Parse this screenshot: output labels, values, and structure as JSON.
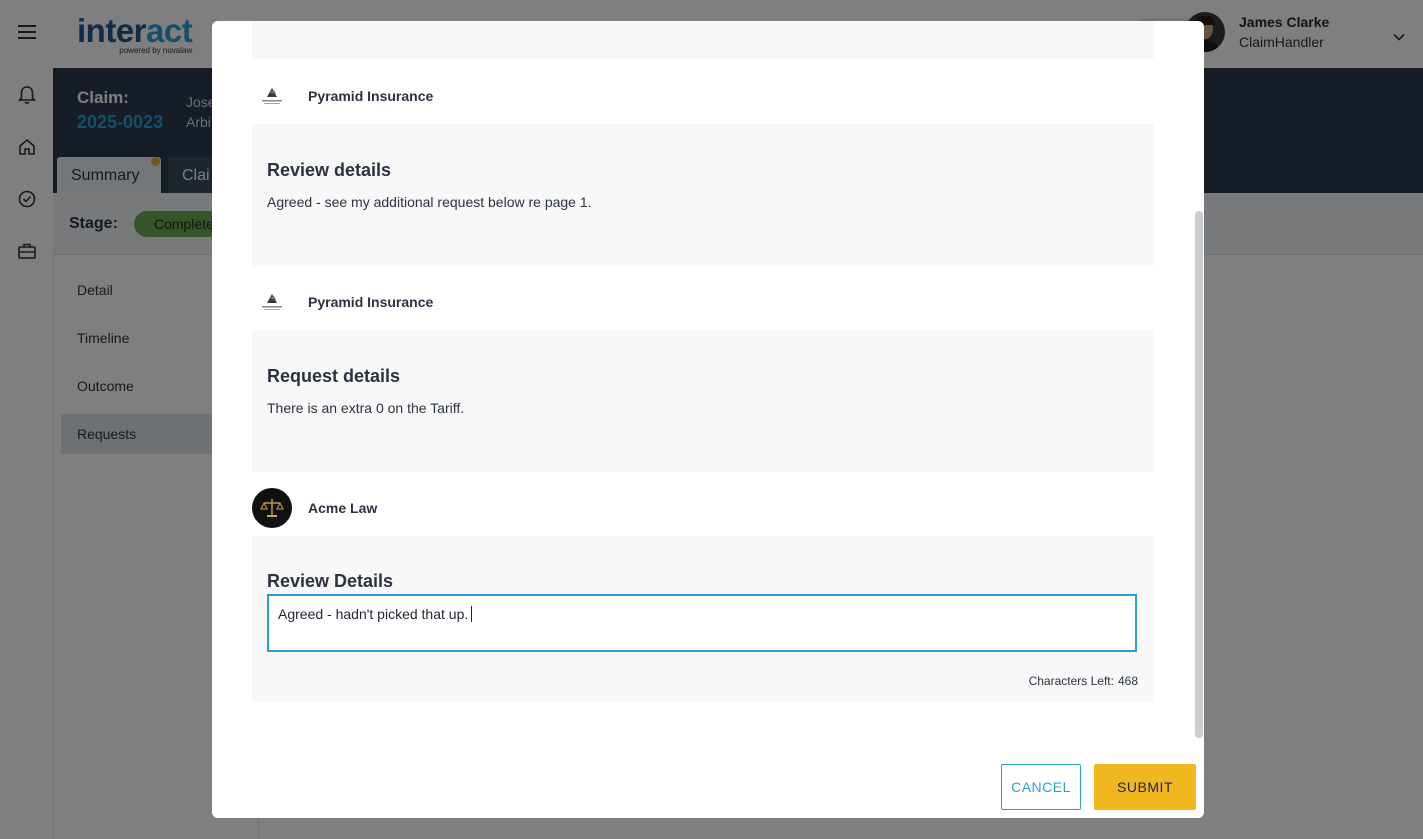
{
  "app": {
    "logo": {
      "main_a": "inter",
      "main_b": "act",
      "sub": "powered by nuvalaw"
    },
    "user": {
      "name": "James Clarke",
      "role": "ClaimHandler"
    },
    "claim": {
      "label": "Claim:",
      "number": "2025-0023",
      "party_line1": "Jose",
      "party_line2": "Arbi"
    },
    "tabs": [
      {
        "label": "Summary"
      },
      {
        "label": "Clai"
      }
    ],
    "stage": {
      "label": "Stage:",
      "value": "Complete"
    },
    "sidenav": [
      {
        "label": "Detail"
      },
      {
        "label": "Timeline"
      },
      {
        "label": "Outcome"
      },
      {
        "label": "Requests"
      }
    ]
  },
  "modal": {
    "entries": [
      {
        "author": "Pyramid Insurance",
        "title": "Review details",
        "text": "Agreed - see my additional request below re page 1."
      },
      {
        "author": "Pyramid Insurance",
        "title": "Request details",
        "text": "There is an extra 0 on the Tariff."
      }
    ],
    "reply": {
      "author": "Acme Law",
      "title": "Review Details",
      "value": "Agreed - hadn't picked that up.",
      "chars_left_label": "Characters Left:",
      "chars_left_value": "468"
    },
    "buttons": {
      "cancel": "CANCEL",
      "submit": "SUBMIT"
    }
  },
  "colors": {
    "brand_blue": "#2a9fd6",
    "brand_dark": "#2c3a4d",
    "accent_yellow": "#f0b81e",
    "stage_green": "#6aa84f"
  },
  "icons": [
    "hamburger-icon",
    "bell-icon",
    "home-icon",
    "check-circle-icon",
    "briefcase-icon",
    "chevron-down-icon"
  ]
}
